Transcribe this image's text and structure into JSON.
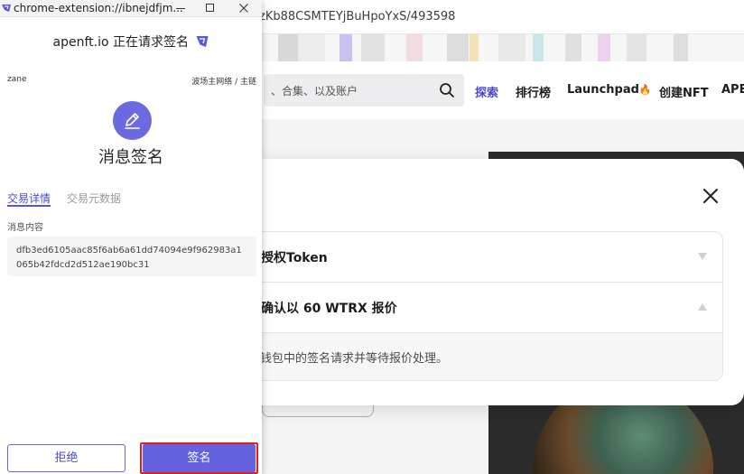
{
  "background_page": {
    "url_fragment": "zKb88CSMTEYjBuHpoYxS/493598",
    "search_placeholder": "、合集、以及账户",
    "nav": [
      {
        "label": "探索",
        "active": true
      },
      {
        "label": "排行榜",
        "active": false
      },
      {
        "label": "Launchpad",
        "active": false
      },
      {
        "label": "创建NFT",
        "active": false
      },
      {
        "label": "APE",
        "active": false
      }
    ],
    "launchpad_emoji": "🔥"
  },
  "modal": {
    "row1_label": "授权Token",
    "row2_label": "确认以 60 WTRX 报价",
    "description": "钱包中的签名请求并等待报价处理。"
  },
  "popup": {
    "window_title": "chrome-extension://ibnejdfjm...",
    "site_heading": "apenft.io 正在请求签名",
    "account_name": "zane",
    "network": "波场主网络 / 主链",
    "sign_title": "消息签名",
    "tabs": [
      {
        "label": "交易详情",
        "active": true
      },
      {
        "label": "交易元数据",
        "active": false
      }
    ],
    "message_label": "消息内容",
    "message_content": "dfb3ed6105aac85f6ab6a61dd74094e9f962983a1065b42fdcd2d512ae190bc31",
    "reject_label": "拒绝",
    "sign_label": "签名"
  },
  "colors": {
    "accent": "#6462dc",
    "accent_text": "#4c48d2",
    "highlight_border": "#e41e1e"
  }
}
